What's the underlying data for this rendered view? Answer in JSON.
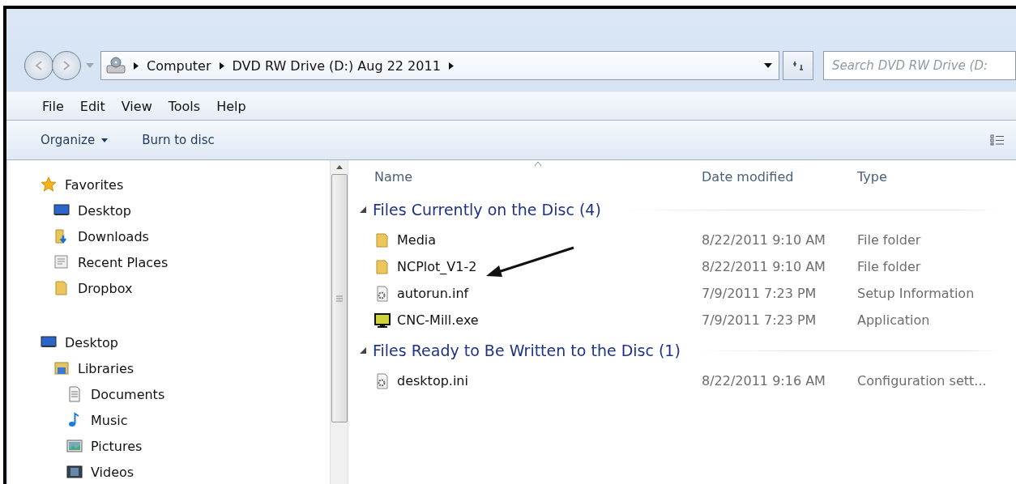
{
  "address_bar": {
    "segments": [
      "Computer",
      "DVD RW Drive (D:) Aug 22 2011"
    ]
  },
  "search": {
    "placeholder": "Search DVD RW Drive (D:"
  },
  "menu": [
    "File",
    "Edit",
    "View",
    "Tools",
    "Help"
  ],
  "toolbar": [
    {
      "label": "Organize",
      "dropdown": true
    },
    {
      "label": "Burn to disc",
      "dropdown": false
    }
  ],
  "nav": [
    {
      "label": "Favorites",
      "kind": "star",
      "children": [
        {
          "label": "Desktop",
          "kind": "desktop"
        },
        {
          "label": "Downloads",
          "kind": "downloads"
        },
        {
          "label": "Recent Places",
          "kind": "recent"
        },
        {
          "label": "Dropbox",
          "kind": "folder"
        }
      ]
    },
    {
      "label": "Desktop",
      "kind": "desktop",
      "children": [
        {
          "label": "Libraries",
          "kind": "library",
          "children": [
            {
              "label": "Documents",
              "kind": "documents"
            },
            {
              "label": "Music",
              "kind": "music"
            },
            {
              "label": "Pictures",
              "kind": "pictures"
            },
            {
              "label": "Videos",
              "kind": "videos"
            }
          ]
        }
      ]
    }
  ],
  "columns": [
    {
      "label": "Name",
      "sorted": true
    },
    {
      "label": "Date modified",
      "sorted": false
    },
    {
      "label": "Type",
      "sorted": false
    }
  ],
  "groups": [
    {
      "title": "Files Currently on the Disc (4)",
      "expanded": true,
      "files": [
        {
          "name": "Media",
          "date": "8/22/2011 9:10 AM",
          "type": "File folder",
          "kind": "folder"
        },
        {
          "name": "NCPlot_V1-2",
          "date": "8/22/2011 9:10 AM",
          "type": "File folder",
          "kind": "folder"
        },
        {
          "name": "autorun.inf",
          "date": "7/9/2011 7:23 PM",
          "type": "Setup Information",
          "kind": "settings-file"
        },
        {
          "name": "CNC-Mill.exe",
          "date": "7/9/2011 7:23 PM",
          "type": "Application",
          "kind": "monitor"
        }
      ]
    },
    {
      "title": "Files Ready to Be Written to the Disc (1)",
      "expanded": true,
      "files": [
        {
          "name": "desktop.ini",
          "date": "8/22/2011 9:16 AM",
          "type": "Configuration sett...",
          "kind": "settings-file"
        }
      ]
    }
  ]
}
